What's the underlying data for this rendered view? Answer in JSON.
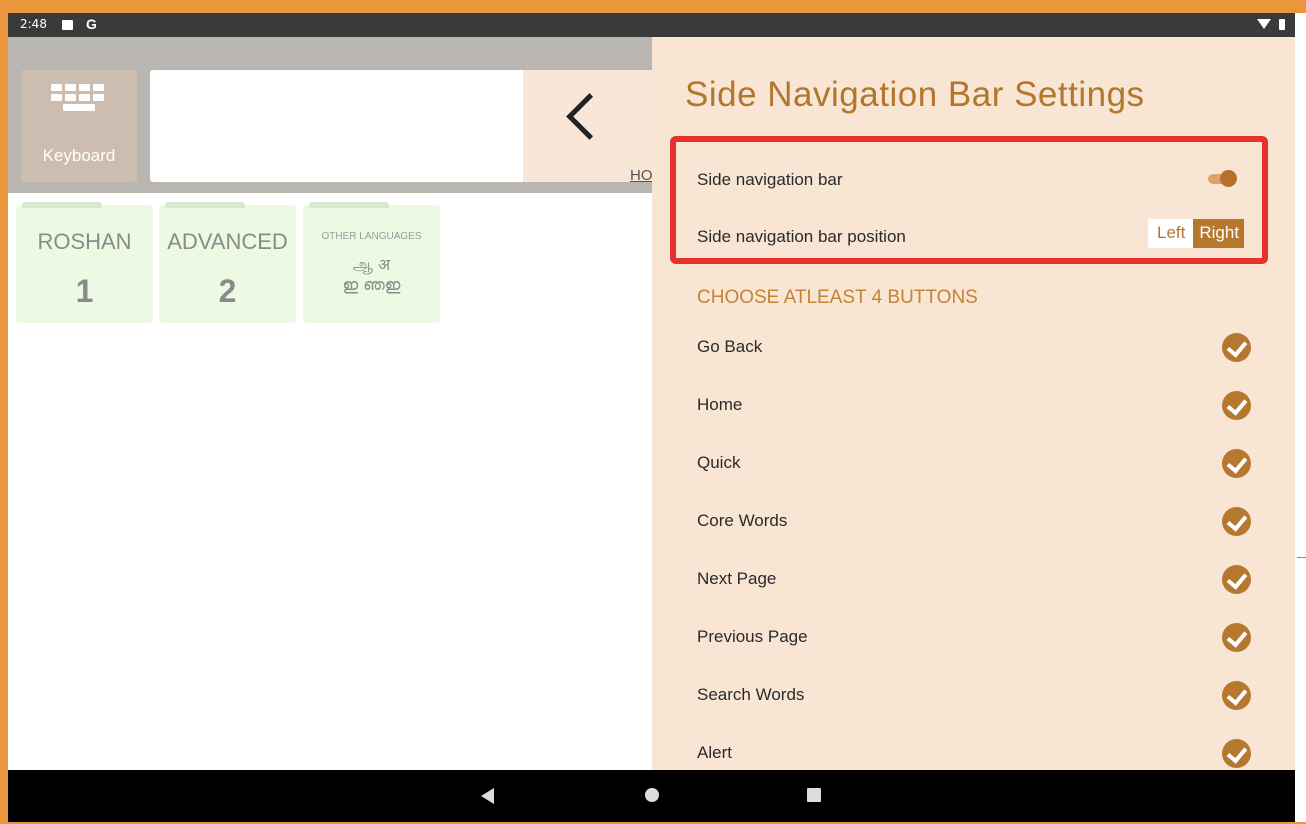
{
  "status_bar": {
    "time": "2:48",
    "g_label": "G"
  },
  "app": {
    "keyboard_label": "Keyboard",
    "ho_label": "HO",
    "folders": [
      {
        "title": "ROSHAN",
        "number": "1"
      },
      {
        "title": "ADVANCED",
        "number": "2"
      }
    ],
    "other_languages": {
      "title": "OTHER LANGUAGES",
      "line1": "ஆ अ",
      "line2": "ഇ ഞഇ"
    }
  },
  "settings": {
    "title": "Side Navigation Bar Settings",
    "side_nav_label": "Side navigation bar",
    "side_nav_enabled": true,
    "position_label": "Side navigation bar position",
    "position_options": [
      "Left",
      "Right"
    ],
    "position_selected": "Right",
    "section_heading": "CHOOSE ATLEAST 4 BUTTONS",
    "buttons": [
      {
        "label": "Go Back",
        "checked": true
      },
      {
        "label": "Home",
        "checked": true
      },
      {
        "label": "Quick",
        "checked": true
      },
      {
        "label": "Core Words",
        "checked": true
      },
      {
        "label": "Next Page",
        "checked": true
      },
      {
        "label": "Previous Page",
        "checked": true
      },
      {
        "label": "Search Words",
        "checked": true
      },
      {
        "label": "Alert",
        "checked": true
      }
    ]
  },
  "colors": {
    "accent": "#b5782e",
    "panel_bg": "#f8e5d4",
    "highlight": "#e7322b",
    "folder_bg": "#ecfae3"
  }
}
